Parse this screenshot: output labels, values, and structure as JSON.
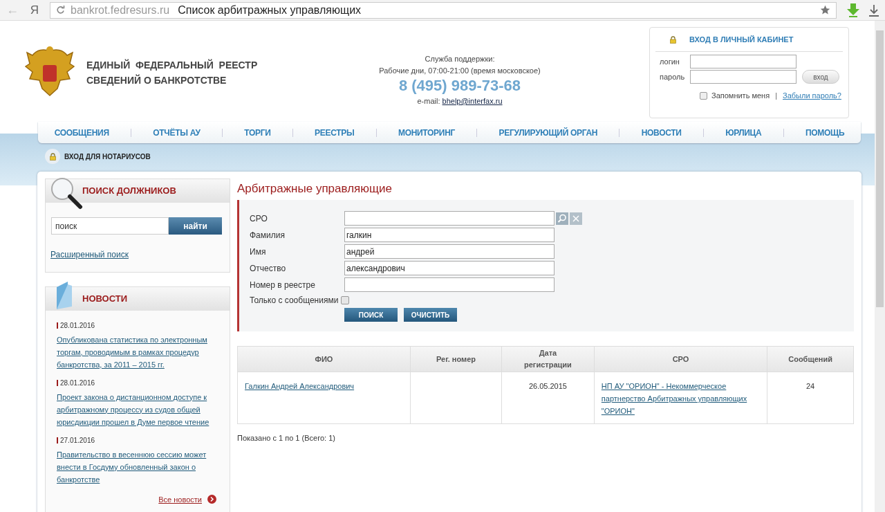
{
  "browser": {
    "back": "←",
    "home": "Я",
    "domain": "bankrot.fedresurs.ru",
    "page_title": "Список арбитражных управляющих"
  },
  "header": {
    "title_lines": [
      "ЕДИНЫЙ  ФЕДЕРАЛЬНЫЙ  РЕЕСТР",
      "СВЕДЕНИЙ О БАНКРОТСТВЕ"
    ],
    "support": {
      "label": "Служба поддержки:",
      "hours": "Рабочие дни, 07:00-21:00 (время московское)",
      "phone": "8 (495) 989-73-68",
      "email_label": "e-mail:",
      "email": "bhelp@interfax.ru"
    },
    "login": {
      "title": "ВХОД В ЛИЧНЫЙ КАБИНЕТ",
      "login_label": "логин",
      "password_label": "пароль",
      "button": "вход",
      "remember_label": "Запомнить меня",
      "remember_checked": false,
      "separator": "|",
      "forgot": "Забыли пароль?"
    }
  },
  "nav": [
    {
      "label": "СООБЩЕНИЯ"
    },
    {
      "label": "ОТЧЁТЫ АУ"
    },
    {
      "label": "ТОРГИ"
    },
    {
      "label": "РЕЕСТРЫ"
    },
    {
      "label": "МОНИТОРИНГ"
    },
    {
      "label": "РЕГУЛИРУЮЩИЙ ОРГАН"
    },
    {
      "label": "НОВОСТИ"
    },
    {
      "label": "ЮРЛИЦА"
    },
    {
      "label": "ПОМОЩЬ"
    }
  ],
  "notary": {
    "label": "ВХОД ДЛЯ НОТАРИУСОВ"
  },
  "debtor_search": {
    "title": "ПОИСК ДОЛЖНИКОВ",
    "value": "поиск",
    "button": "найти",
    "advanced": "Расширенный поиск"
  },
  "news": {
    "title": "НОВОСТИ",
    "items": [
      {
        "date": "28.01.2016",
        "text": "Опубликована статистика по электронным торгам, проводимым в рамках процедур банкротства, за 2011 – 2015 гг."
      },
      {
        "date": "28.01.2016",
        "text": "Проект закона о дистанционном доступе к арбитражному процессу из судов общей юрисдикции прошел в Думе первое чтение"
      },
      {
        "date": "27.01.2016",
        "text": "Правительство в весеннюю сессию может внести в Госдуму обновленный закон о банкротстве"
      }
    ],
    "all": "Все новости"
  },
  "main": {
    "title": "Арбитражные управляющие",
    "fields": [
      {
        "label": "СРО",
        "kind": "lookup"
      },
      {
        "label": "Фамилия",
        "value": "галкин",
        "kind": "text"
      },
      {
        "label": "Имя",
        "value": "андрей",
        "kind": "text"
      },
      {
        "label": "Отчество",
        "value": "александрович",
        "kind": "text"
      },
      {
        "label": "Номер в реестре",
        "kind": "text"
      }
    ],
    "only_messages": {
      "label": "Только с сообщениями",
      "checked": false
    },
    "buttons": [
      "ПОИСК",
      "ОЧИСТИТЬ"
    ],
    "table": {
      "columns": [
        "ФИО",
        "Рег. номер",
        "Дата регистрации",
        "СРО",
        "Сообщений"
      ],
      "rows": [
        {
          "name": "Галкин Андрей Александрович",
          "date": "26.05.2015",
          "sro": "НП АУ \"ОРИОН\" - Некоммерческое партнерство Арбитражных управляющих \"ОРИОН\"",
          "messages": "24"
        }
      ]
    },
    "summary": "Показано с 1 по 1 (Всего: 1)"
  }
}
